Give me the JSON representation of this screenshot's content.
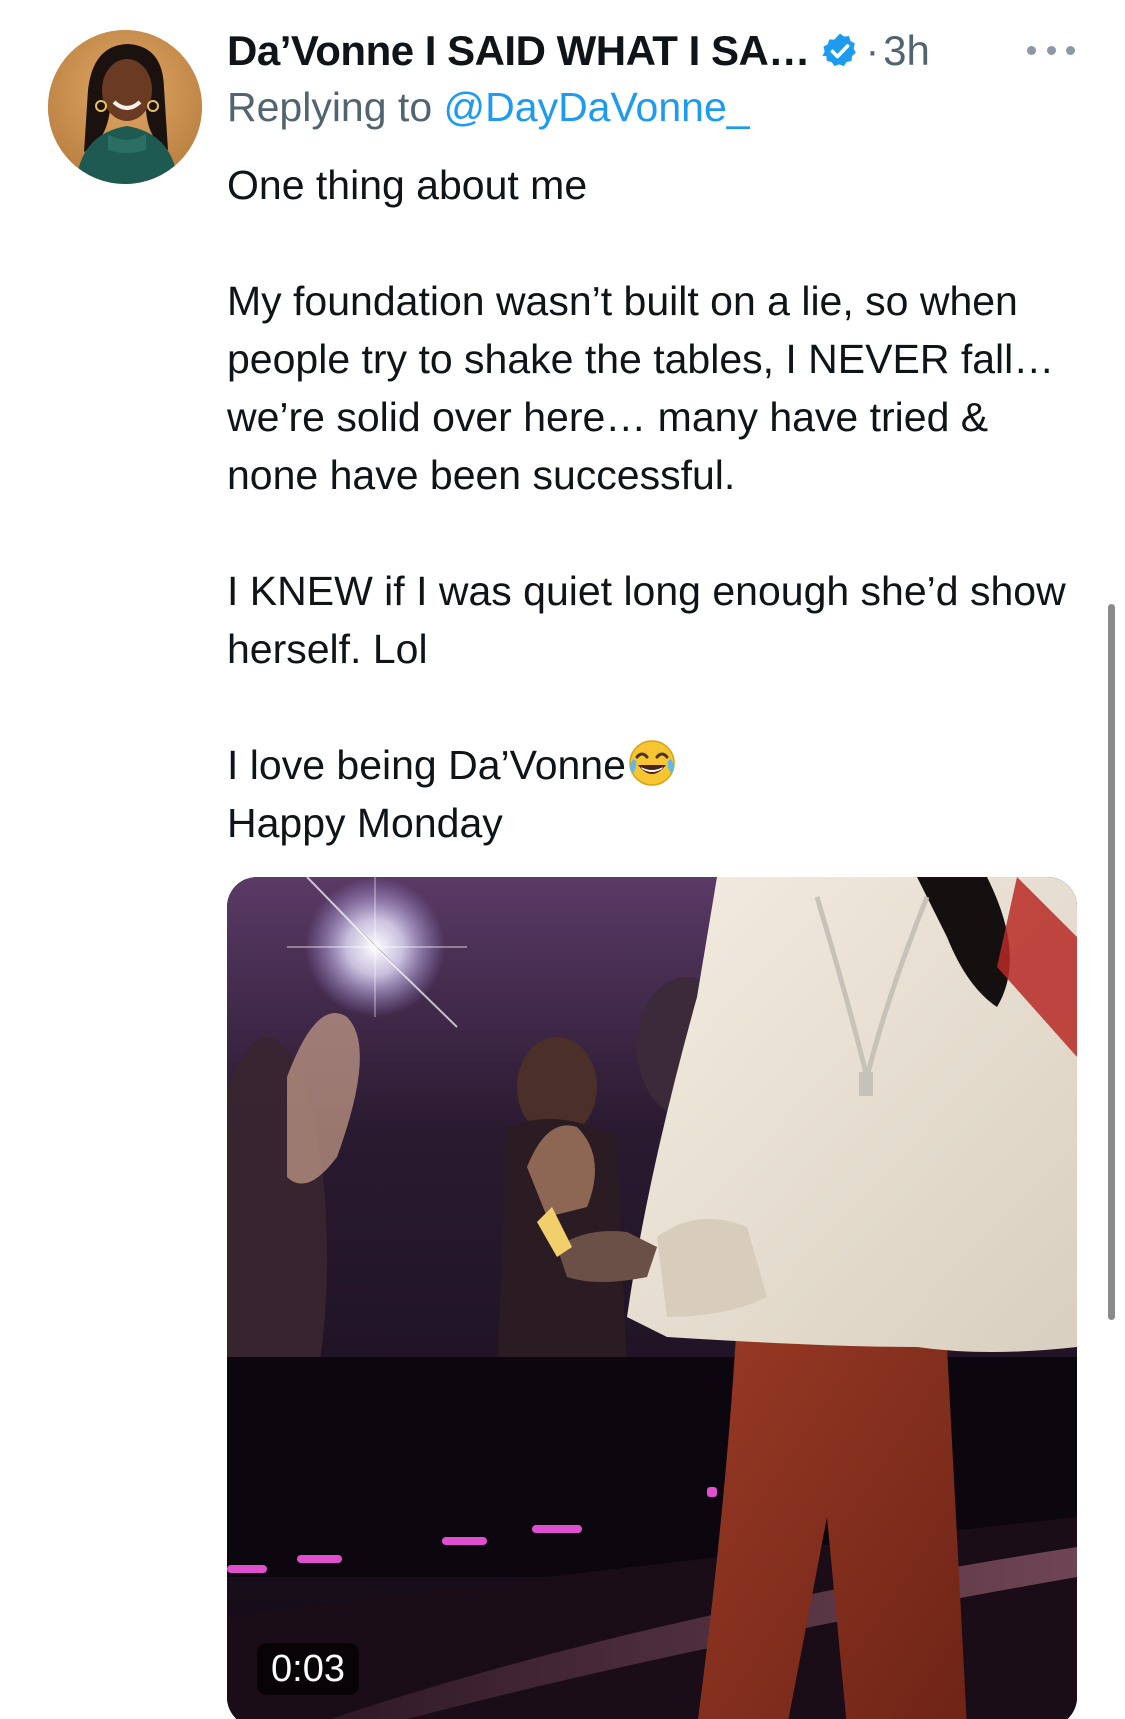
{
  "tweet": {
    "display_name": "Da’Vonne I SAID WHAT I SA…",
    "verified_icon": "verified-badge-icon",
    "separator": "·",
    "timestamp": "3h",
    "more_icon": "more-options-icon",
    "reply_prefix": "Replying to",
    "reply_handle": "@DayDaVonne_",
    "paragraphs": [
      "One thing about me",
      "My foundation wasn’t built on a lie, so when people try to shake the tables, I NEVER fall… we’re solid over here… many have tried & none have been successful.",
      "I KNEW if I was quiet long enough she’d show herself. Lol"
    ],
    "last_line_1": "I love being Da’Vonne",
    "emoji": "face-with-tears-of-joy-icon",
    "last_line_2": "Happy Monday"
  },
  "media": {
    "type": "video",
    "duration": "0:03"
  },
  "colors": {
    "link_blue": "#1d9bf0",
    "secondary_text": "#536471",
    "primary_text": "#0f1419"
  }
}
